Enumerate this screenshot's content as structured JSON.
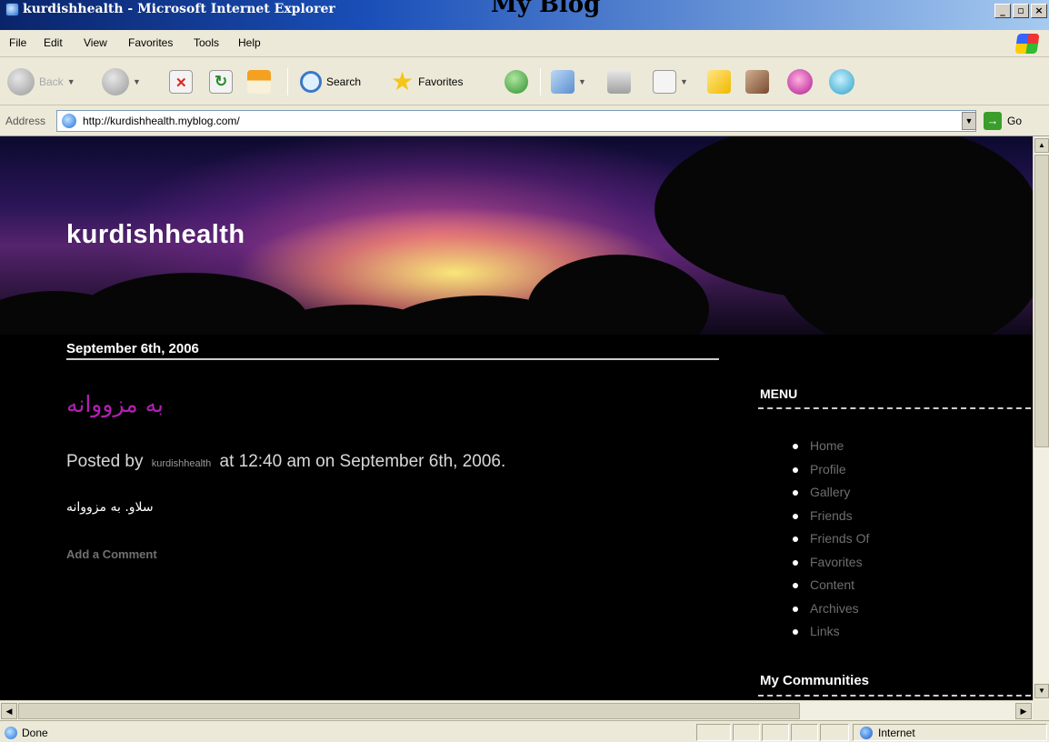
{
  "window": {
    "title": "kurdishhealth - Microsoft Internet Explorer",
    "top_heading": "My Blog"
  },
  "menu": {
    "items": [
      "File",
      "Edit",
      "View",
      "Favorites",
      "Tools",
      "Help"
    ]
  },
  "toolbar": {
    "back": "Back",
    "search": "Search",
    "favorites": "Favorites"
  },
  "address": {
    "label": "Address",
    "url": "http://kurdishhealth.myblog.com/",
    "go": "Go"
  },
  "blog": {
    "title": "kurdishhealth",
    "post_date": "September 6th, 2006",
    "post_title": "به مزووانه",
    "posted_by_prefix": "Posted by",
    "author": "kurdishhealth",
    "posted_by_suffix": "at 12:40 am on September 6th, 2006.",
    "body": "سلاو. به مزووانه",
    "add_comment": "Add a Comment"
  },
  "sidebar": {
    "menu_heading": "MENU",
    "items": [
      "Home",
      "Profile",
      "Gallery",
      "Friends",
      "Friends Of",
      "Favorites",
      "Content",
      "Archives",
      "Links"
    ],
    "communities_heading": "My Communities"
  },
  "status": {
    "text": "Done",
    "zone": "Internet"
  },
  "colors": {
    "post_title": "#b21fb2",
    "page_background": "#000000",
    "title_bar": "#0a246a"
  },
  "icons": [
    "back-arrow-icon",
    "forward-arrow-icon",
    "stop-icon",
    "refresh-icon",
    "home-icon",
    "search-icon",
    "favorites-star-icon",
    "history-icon",
    "mail-icon",
    "print-icon",
    "edit-icon",
    "folder-icon",
    "messenger-icon",
    "go-arrow-icon",
    "ie-page-icon",
    "internet-zone-icon"
  ]
}
